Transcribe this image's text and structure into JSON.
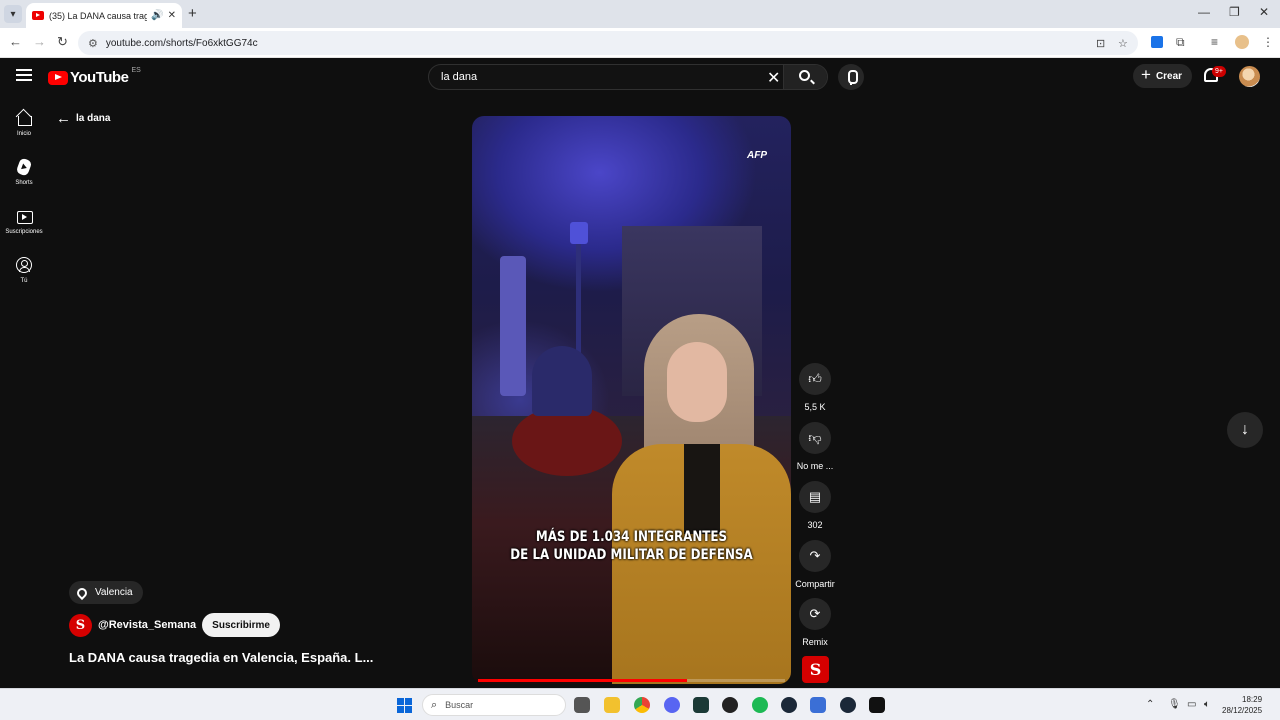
{
  "browser": {
    "tab_title": "(35) La DANA causa traged",
    "url": "youtube.com/shorts/Fo6xktGG74c"
  },
  "header": {
    "logo_text": "YouTube",
    "country_code": "ES",
    "search_value": "la dana",
    "create_label": "Crear",
    "notifications_badge": "9+"
  },
  "sidebar": {
    "items": [
      {
        "label": "Inicio",
        "icon": "home-icon"
      },
      {
        "label": "Shorts",
        "icon": "shorts-icon"
      },
      {
        "label": "Suscripciones",
        "icon": "subscriptions-icon"
      },
      {
        "label": "Tú",
        "icon": "you-icon"
      }
    ]
  },
  "back_label": "la dana",
  "video": {
    "watermark": "AFP",
    "caption_line1": "MÁS DE 1.034 INTEGRANTES",
    "caption_line2": "DE LA UNIDAD MILITAR DE DEFENSA",
    "progress": 0.68
  },
  "actions": {
    "like_count": "5,5 K",
    "dislike_label": "No me ...",
    "comments_count": "302",
    "share_label": "Compartir",
    "remix_label": "Remix"
  },
  "info": {
    "location": "Valencia",
    "channel_handle": "@Revista_Semana",
    "channel_initial": "S",
    "subscribe_label": "Suscribirme",
    "title": "La DANA causa tragedia en Valencia, España. L..."
  },
  "taskbar": {
    "search_placeholder": "Buscar",
    "time": "18:29",
    "date": "28/12/2025"
  },
  "colors": {
    "accent": "#ff0000",
    "background": "#0f0f0f",
    "channel_red": "#d50000"
  }
}
